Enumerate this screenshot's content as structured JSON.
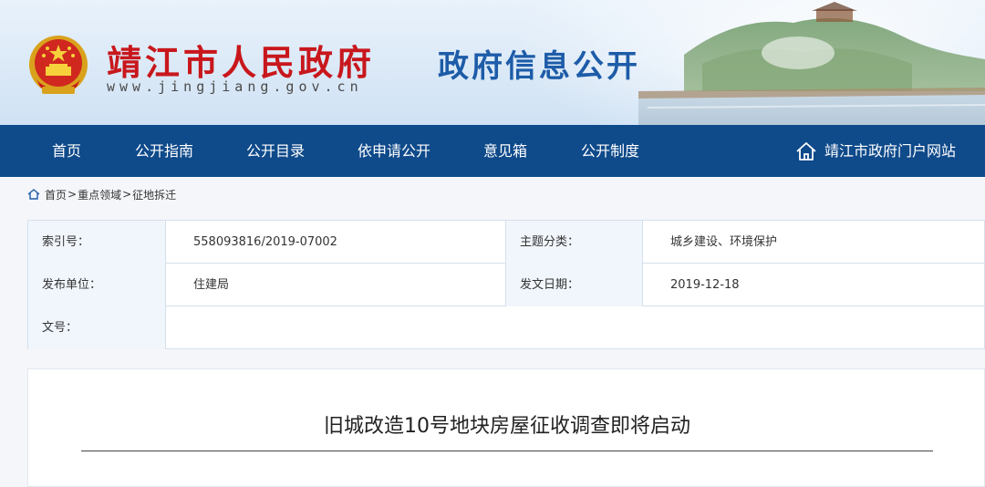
{
  "header": {
    "site_name": "靖江市人民政府",
    "site_url": "www.jingjiang.gov.cn",
    "section_title": "政府信息公开"
  },
  "colors": {
    "brand_red": "#c8171c",
    "nav_blue": "#0f4a8a",
    "title_blue": "#1d5ca8",
    "label_bg": "#f1f6fc"
  },
  "nav": {
    "items": [
      {
        "label": "首页"
      },
      {
        "label": "公开指南"
      },
      {
        "label": "公开目录"
      },
      {
        "label": "依申请公开"
      },
      {
        "label": "意见箱"
      },
      {
        "label": "公开制度"
      }
    ],
    "portal_label": "靖江市政府门户网站",
    "portal_icon": "home-outline-icon"
  },
  "breadcrumb": {
    "icon": "home-icon",
    "items": [
      "首页",
      "重点领域",
      "征地拆迁"
    ],
    "separator": ">"
  },
  "meta": {
    "index_label": "索引号：",
    "index_value": "558093816/2019-07002",
    "topic_label": "主题分类：",
    "topic_value": "城乡建设、环境保护",
    "publisher_label": "发布单位：",
    "publisher_value": "住建局",
    "date_label": "发文日期：",
    "date_value": "2019-12-18",
    "docno_label": "文号：",
    "docno_value": ""
  },
  "article": {
    "title": "旧城改造10号地块房屋征收调查即将启动"
  }
}
